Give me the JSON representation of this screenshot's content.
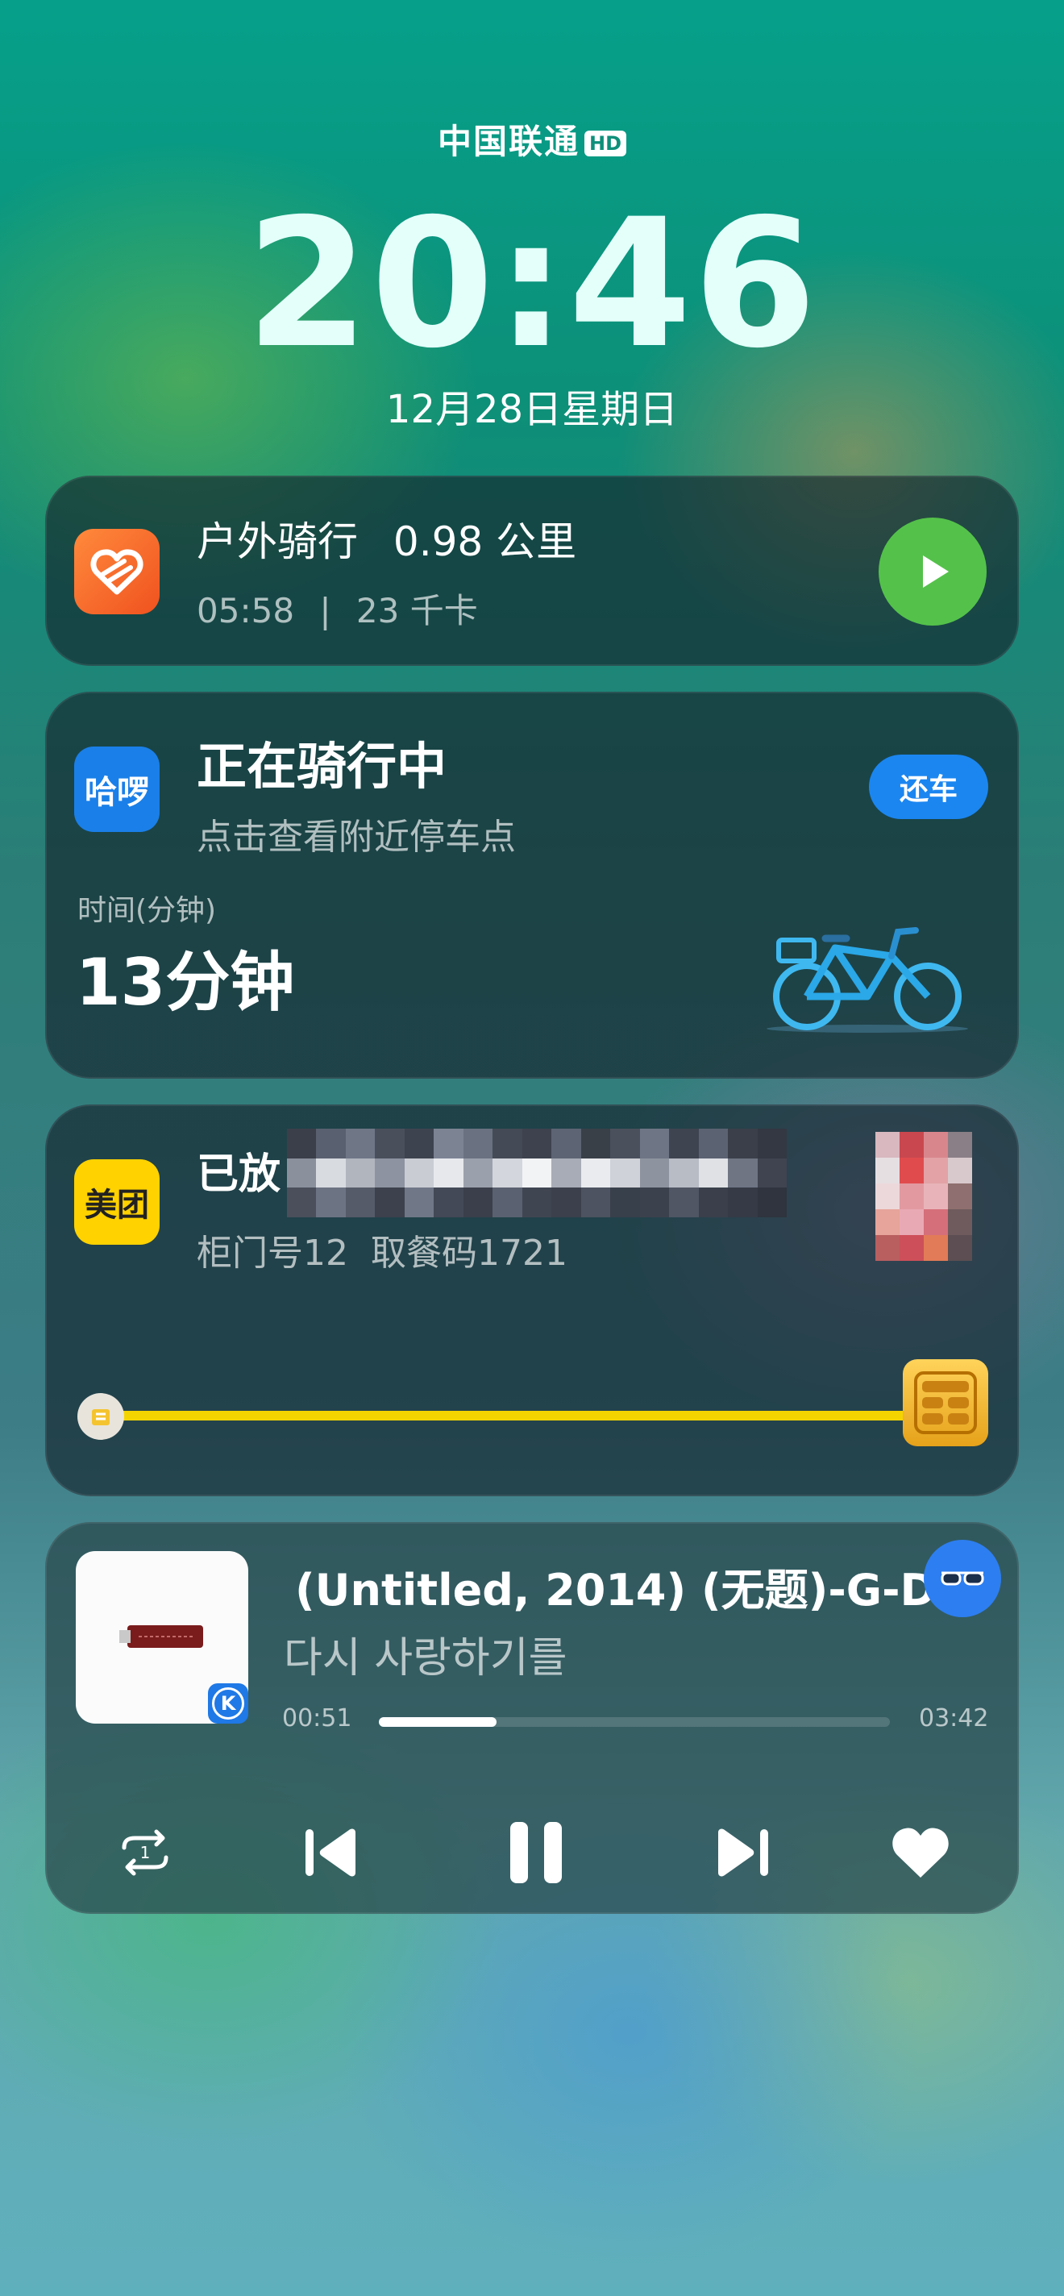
{
  "status": {
    "carrier": "中国联通",
    "carrier_badge": "HD",
    "time": "20:46",
    "date": "12月28日星期日"
  },
  "ride_card": {
    "title": "户外骑行",
    "distance": "0.98 公里",
    "duration": "05:58",
    "separator": "|",
    "calories": "23 千卡",
    "icon": "heart-health-app-icon",
    "play_icon": "play-icon"
  },
  "hellobike_card": {
    "app_label": "哈啰",
    "title": "正在骑行中",
    "subtitle": "点击查看附近停车点",
    "return_button": "还车",
    "time_label": "时间(分钟)",
    "time_value": "13分钟",
    "illustration": "bicycle-icon"
  },
  "meituan_card": {
    "app_label": "美团",
    "title": "已放",
    "detail": "柜门号12  取餐码1721",
    "progress": 1.0,
    "progress_color": "#f4d400",
    "start_icon": "bag-icon",
    "end_icon": "locker-icon"
  },
  "music_card": {
    "song_title": "(Untitled, 2014) (无题)-G-D",
    "lyric": "다시 사랑하기를",
    "elapsed": "00:51",
    "total": "03:42",
    "progress": 0.23,
    "album_badge": "K",
    "controls": [
      "repeat-one-icon",
      "previous-icon",
      "pause-icon",
      "next-icon",
      "heart-icon"
    ],
    "repeat_count": "1",
    "glasses_icon": "glasses-icon"
  }
}
